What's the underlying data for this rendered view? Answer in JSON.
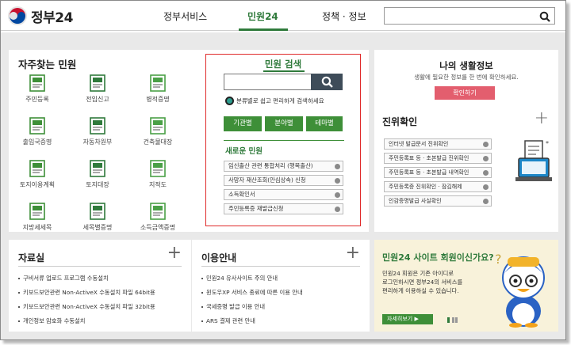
{
  "header": {
    "logo_text": "정부24",
    "nav": [
      "정부서비스",
      "민원24",
      "정책 · 정보"
    ],
    "active_nav_index": 1,
    "search_placeholder": ""
  },
  "frequent": {
    "title": "자주찾는 민원",
    "items": [
      {
        "label": "주민등록",
        "icon": "resident-registration-icon"
      },
      {
        "label": "전입신고",
        "icon": "house-move-icon"
      },
      {
        "label": "병적증명",
        "icon": "military-record-icon"
      },
      {
        "label": "출입국증명",
        "icon": "immigration-icon"
      },
      {
        "label": "자동차원부",
        "icon": "car-register-icon"
      },
      {
        "label": "건축물대장",
        "icon": "building-register-icon"
      },
      {
        "label": "토지이용계획",
        "icon": "land-use-icon"
      },
      {
        "label": "토지대장",
        "icon": "land-register-icon"
      },
      {
        "label": "지적도",
        "icon": "cadastral-map-icon"
      },
      {
        "label": "지방세세목",
        "icon": "local-tax-icon"
      },
      {
        "label": "세목별증명",
        "icon": "tax-item-icon"
      },
      {
        "label": "소득금액증명",
        "icon": "income-certificate-icon"
      }
    ]
  },
  "civil_search": {
    "title": "민원 검색",
    "input_value": "",
    "help_text": "분류별로 쉽고 편리하게 검색하세요",
    "categories": [
      "기관별",
      "분야별",
      "테마별"
    ],
    "new_title": "새로운 민원",
    "new_items": [
      "임신출산 관련 통합처리 (행복출산)",
      "사망자 재산조회(안심상속) 신청",
      "소득확인서",
      "주민등록증 재발급신청"
    ]
  },
  "life_info": {
    "title": "나의 생활정보",
    "desc": "생활에 필요한 정보를 한 번에 확인하세요.",
    "button": "확인하기"
  },
  "verify": {
    "title": "진위확인",
    "items": [
      "인터넷 발급문서 진위확인",
      "주민등록표 등 · 초본발급 진위확인",
      "주민등록표 등 · 초본발급 내역확인",
      "주민등록증 진위확인 · 잠김해제",
      "인감증명발급 사실확인"
    ]
  },
  "data_room": {
    "title": "자료실",
    "items": [
      "구비서류 업로드 프로그램 수동설치",
      "키보드보안관련 Non-ActiveX 수동설치 파일 64bit용",
      "키보드보안관련 Non-ActiveX 수동설치 파일 32bit용",
      "개인정보 암호화 수동설치"
    ]
  },
  "usage_guide": {
    "title": "이용안내",
    "items": [
      "민원24 유사사이트 주의 안내",
      "윈도우XP 서비스 종료에 따른 이용 안내",
      "국세증명 발급 이용 안내",
      "ARS 결제 관련 안내"
    ]
  },
  "member": {
    "title": "민원24 사이트 회원이신가요?",
    "desc_lines": [
      "민원24 회원은 기존 아이디로",
      "로그인하시면 정부24의 서비스를",
      "편리하게 이용하실 수 있습니다."
    ],
    "button": "자세히보기"
  },
  "colors": {
    "brand_green": "#2f7a3b",
    "button_green": "#3e8f38",
    "highlight_red": "#e02a2a",
    "pink_button": "#e35e6e"
  }
}
